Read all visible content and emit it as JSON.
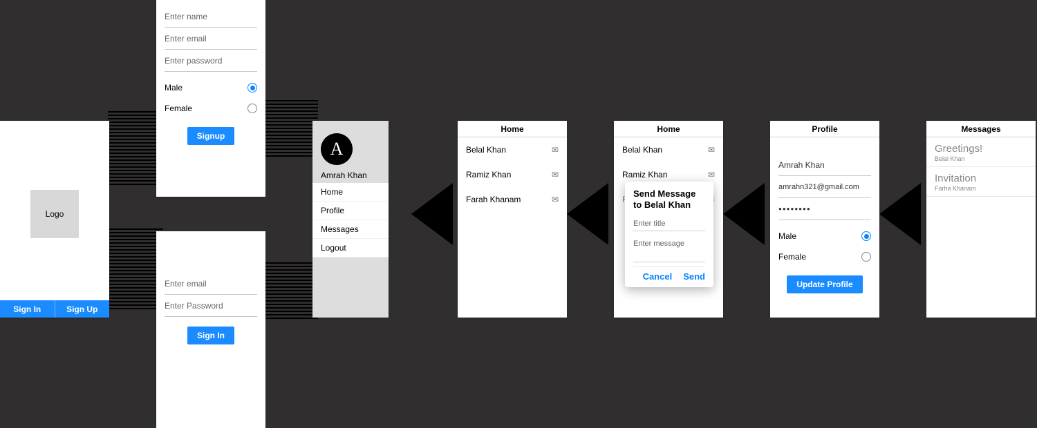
{
  "landing": {
    "logo_text": "Logo",
    "sign_in": "Sign In",
    "sign_up": "Sign Up"
  },
  "signup": {
    "name_ph": "Enter name",
    "email_ph": "Enter email",
    "password_ph": "Enter password",
    "male": "Male",
    "female": "Female",
    "button": "Signup"
  },
  "signin": {
    "email_ph": "Enter email",
    "password_ph": "Enter Password",
    "button": "Sign In"
  },
  "drawer": {
    "avatar_letter": "A",
    "username": "Amrah Khan",
    "items": [
      "Home",
      "Profile",
      "Messages",
      "Logout"
    ]
  },
  "home": {
    "title": "Home",
    "contacts": [
      "Belal Khan",
      "Ramiz Khan",
      "Farah Khanam"
    ]
  },
  "dialog": {
    "title_l1": "Send Message",
    "title_l2": "to Belal Khan",
    "title_ph": "Enter title",
    "msg_ph": "Enter message",
    "cancel": "Cancel",
    "send": "Send"
  },
  "profile": {
    "title": "Profile",
    "name": "Amrah Khan",
    "email": "amrahn321@gmail.com",
    "password": "●●●●●●●●",
    "male": "Male",
    "female": "Female",
    "button": "Update Profile"
  },
  "messages": {
    "title": "Messages",
    "items": [
      {
        "title": "Greetings!",
        "sender": "Belal Khan"
      },
      {
        "title": "Invitation",
        "sender": "Farha Khanam"
      }
    ]
  }
}
